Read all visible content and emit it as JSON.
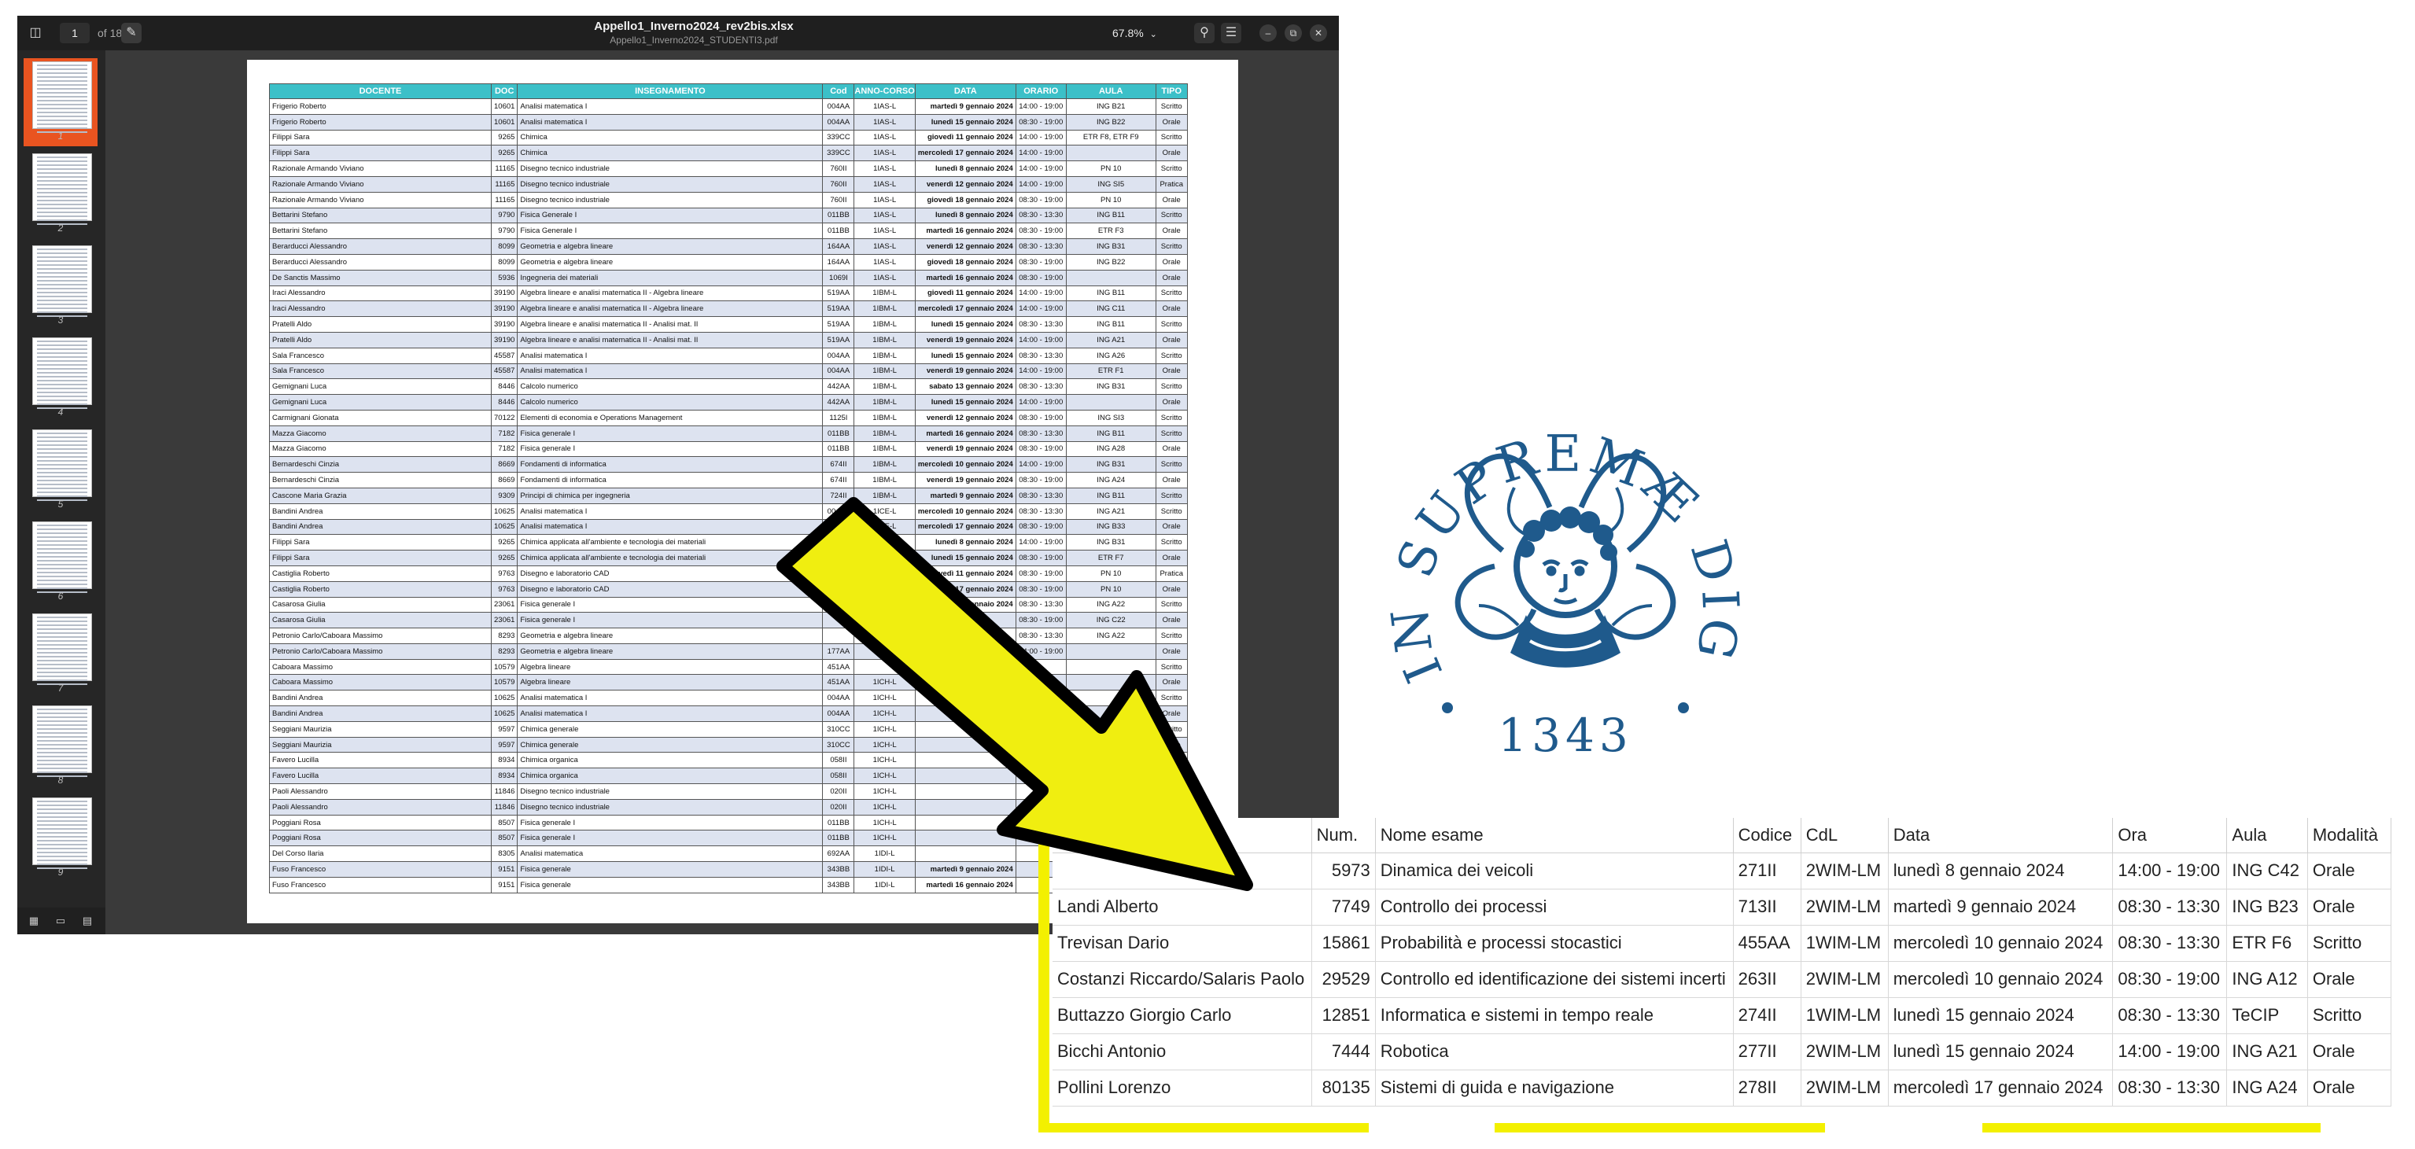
{
  "viewer": {
    "title": "Appello1_Inverno2024_rev2bis.xlsx",
    "subtitle": "Appello1_Inverno2024_STUDENTI3.pdf",
    "current_page": "1",
    "page_count_label": "of 18",
    "zoom_level": "67.8%",
    "accent_color": "#e95420",
    "thumbnail_labels": [
      "1",
      "2",
      "3",
      "4",
      "5",
      "6",
      "7",
      "8",
      "9"
    ]
  },
  "pdf_table": {
    "header_color": "#3cc0c8",
    "columns": [
      "DOCENTE",
      "DOC",
      "INSEGNAMENTO",
      "Cod",
      "ANNO-CORSO",
      "DATA",
      "ORARIO",
      "AULA",
      "TIPO"
    ],
    "rows": [
      [
        "Frigerio Roberto",
        "10601",
        "Analisi matematica I",
        "004AA",
        "1IAS-L",
        "martedì 9 gennaio 2024",
        "14:00 - 19:00",
        "ING B21",
        "Scritto"
      ],
      [
        "Frigerio Roberto",
        "10601",
        "Analisi matematica I",
        "004AA",
        "1IAS-L",
        "lunedì 15 gennaio 2024",
        "08:30 - 19:00",
        "ING B22",
        "Orale"
      ],
      [
        "Filippi Sara",
        "9265",
        "Chimica",
        "339CC",
        "1IAS-L",
        "giovedì 11 gennaio 2024",
        "14:00 - 19:00",
        "ETR F8, ETR F9",
        "Scritto"
      ],
      [
        "Filippi Sara",
        "9265",
        "Chimica",
        "339CC",
        "1IAS-L",
        "mercoledì 17 gennaio 2024",
        "14:00 - 19:00",
        "",
        "Orale"
      ],
      [
        "Razionale Armando Viviano",
        "11165",
        "Disegno tecnico industriale",
        "760II",
        "1IAS-L",
        "lunedì 8 gennaio 2024",
        "14:00 - 19:00",
        "PN 10",
        "Scritto"
      ],
      [
        "Razionale Armando Viviano",
        "11165",
        "Disegno tecnico industriale",
        "760II",
        "1IAS-L",
        "venerdì 12 gennaio 2024",
        "14:00 - 19:00",
        "ING SI5",
        "Pratica"
      ],
      [
        "Razionale Armando Viviano",
        "11165",
        "Disegno tecnico industriale",
        "760II",
        "1IAS-L",
        "giovedì 18 gennaio 2024",
        "08:30 - 19:00",
        "PN 10",
        "Orale"
      ],
      [
        "Bettarini Stefano",
        "9790",
        "Fisica Generale I",
        "011BB",
        "1IAS-L",
        "lunedì 8 gennaio 2024",
        "08:30 - 13:30",
        "ING B11",
        "Scritto"
      ],
      [
        "Bettarini Stefano",
        "9790",
        "Fisica Generale I",
        "011BB",
        "1IAS-L",
        "martedì 16 gennaio 2024",
        "08:30 - 19:00",
        "ETR F3",
        "Orale"
      ],
      [
        "Berarducci Alessandro",
        "8099",
        "Geometria e algebra lineare",
        "164AA",
        "1IAS-L",
        "venerdì 12 gennaio 2024",
        "08:30 - 13:30",
        "ING B31",
        "Scritto"
      ],
      [
        "Berarducci Alessandro",
        "8099",
        "Geometria e algebra lineare",
        "164AA",
        "1IAS-L",
        "giovedì 18 gennaio 2024",
        "08:30 - 19:00",
        "ING B22",
        "Orale"
      ],
      [
        "De Sanctis Massimo",
        "5936",
        "Ingegneria dei materiali",
        "1069I",
        "1IAS-L",
        "martedì 16 gennaio 2024",
        "08:30 - 19:00",
        "",
        "Orale"
      ],
      [
        "Iraci Alessandro",
        "39190",
        "Algebra lineare e analisi matematica II - Algebra lineare",
        "519AA",
        "1IBM-L",
        "giovedì 11 gennaio 2024",
        "14:00 - 19:00",
        "ING B11",
        "Scritto"
      ],
      [
        "Iraci Alessandro",
        "39190",
        "Algebra lineare e analisi matematica II - Algebra lineare",
        "519AA",
        "1IBM-L",
        "mercoledì 17 gennaio 2024",
        "14:00 - 19:00",
        "ING C11",
        "Orale"
      ],
      [
        "Pratelli Aldo",
        "39190",
        "Algebra lineare e analisi matematica II - Analisi mat. II",
        "519AA",
        "1IBM-L",
        "lunedì 15 gennaio 2024",
        "08:30 - 13:30",
        "ING B11",
        "Scritto"
      ],
      [
        "Pratelli Aldo",
        "39190",
        "Algebra lineare e analisi matematica II - Analisi mat. II",
        "519AA",
        "1IBM-L",
        "venerdì 19 gennaio 2024",
        "14:00 - 19:00",
        "ING A21",
        "Orale"
      ],
      [
        "Sala Francesco",
        "45587",
        "Analisi matematica I",
        "004AA",
        "1IBM-L",
        "lunedì 15 gennaio 2024",
        "08:30 - 13:30",
        "ING A26",
        "Scritto"
      ],
      [
        "Sala Francesco",
        "45587",
        "Analisi matematica I",
        "004AA",
        "1IBM-L",
        "venerdì 19 gennaio 2024",
        "14:00 - 19:00",
        "ETR F1",
        "Orale"
      ],
      [
        "Gemignani Luca",
        "8446",
        "Calcolo numerico",
        "442AA",
        "1IBM-L",
        "sabato 13 gennaio 2024",
        "08:30 - 13:30",
        "ING B31",
        "Scritto"
      ],
      [
        "Gemignani Luca",
        "8446",
        "Calcolo numerico",
        "442AA",
        "1IBM-L",
        "lunedì 15 gennaio 2024",
        "14:00 - 19:00",
        "",
        "Orale"
      ],
      [
        "Carmignani Gionata",
        "70122",
        "Elementi di economia e Operations Management",
        "1125I",
        "1IBM-L",
        "venerdì 12 gennaio 2024",
        "08:30 - 19:00",
        "ING SI3",
        "Scritto"
      ],
      [
        "Mazza Giacomo",
        "7182",
        "Fisica generale I",
        "011BB",
        "1IBM-L",
        "martedì 16 gennaio 2024",
        "08:30 - 13:30",
        "ING B11",
        "Scritto"
      ],
      [
        "Mazza Giacomo",
        "7182",
        "Fisica generale I",
        "011BB",
        "1IBM-L",
        "venerdì 19 gennaio 2024",
        "08:30 - 19:00",
        "ING A28",
        "Orale"
      ],
      [
        "Bernardeschi Cinzia",
        "8669",
        "Fondamenti di informatica",
        "674II",
        "1IBM-L",
        "mercoledì 10 gennaio 2024",
        "14:00 - 19:00",
        "ING B31",
        "Scritto"
      ],
      [
        "Bernardeschi Cinzia",
        "8669",
        "Fondamenti di informatica",
        "674II",
        "1IBM-L",
        "venerdì 19 gennaio 2024",
        "08:30 - 19:00",
        "ING A24",
        "Orale"
      ],
      [
        "Cascone Maria Grazia",
        "9309",
        "Principi di chimica per ingegneria",
        "724II",
        "1IBM-L",
        "martedì 9 gennaio 2024",
        "08:30 - 13:30",
        "ING B11",
        "Scritto"
      ],
      [
        "Bandini Andrea",
        "10625",
        "Analisi matematica I",
        "004AA",
        "1ICE-L",
        "mercoledì 10 gennaio 2024",
        "08:30 - 13:30",
        "ING A21",
        "Scritto"
      ],
      [
        "Bandini Andrea",
        "10625",
        "Analisi matematica I",
        "004AA",
        "1ICE-L",
        "mercoledì 17 gennaio 2024",
        "08:30 - 19:00",
        "ING B33",
        "Orale"
      ],
      [
        "Filippi Sara",
        "9265",
        "Chimica applicata all'ambiente e tecnologia dei materiali",
        "",
        "1ICE-L",
        "lunedì 8 gennaio 2024",
        "14:00 - 19:00",
        "ING B31",
        "Scritto"
      ],
      [
        "Filippi Sara",
        "9265",
        "Chimica applicata all'ambiente e tecnologia dei materiali",
        "",
        "1ICE-L",
        "lunedì 15 gennaio 2024",
        "08:30 - 19:00",
        "ETR F7",
        "Orale"
      ],
      [
        "Castiglia Roberto",
        "9763",
        "Disegno e laboratorio CAD",
        "",
        "",
        "giovedì 11 gennaio 2024",
        "08:30 - 19:00",
        "PN 10",
        "Pratica"
      ],
      [
        "Castiglia Roberto",
        "9763",
        "Disegno e laboratorio CAD",
        "",
        "",
        "mercoledì 17 gennaio 2024",
        "08:30 - 19:00",
        "PN 10",
        "Orale"
      ],
      [
        "Casarosa Giulia",
        "23061",
        "Fisica generale I",
        "",
        "",
        "venerdì 12 gennaio 2024",
        "08:30 - 13:30",
        "ING A22",
        "Scritto"
      ],
      [
        "Casarosa Giulia",
        "23061",
        "Fisica generale I",
        "",
        "",
        "",
        "08:30 - 19:00",
        "ING C22",
        "Orale"
      ],
      [
        "Petronio Carlo/Caboara Massimo",
        "8293",
        "Geometria e algebra lineare",
        "",
        "",
        "",
        "08:30 - 13:30",
        "ING A22",
        "Scritto"
      ],
      [
        "Petronio Carlo/Caboara Massimo",
        "8293",
        "Geometria e algebra lineare",
        "177AA",
        "",
        "",
        "14:00 - 19:00",
        "",
        "Orale"
      ],
      [
        "Caboara Massimo",
        "10579",
        "Algebra lineare",
        "451AA",
        "",
        "",
        "",
        "",
        "Scritto"
      ],
      [
        "Caboara Massimo",
        "10579",
        "Algebra lineare",
        "451AA",
        "1ICH-L",
        "",
        "",
        "",
        "Orale"
      ],
      [
        "Bandini Andrea",
        "10625",
        "Analisi matematica I",
        "004AA",
        "1ICH-L",
        "",
        "",
        "",
        "Scritto"
      ],
      [
        "Bandini Andrea",
        "10625",
        "Analisi matematica I",
        "004AA",
        "1ICH-L",
        "",
        "",
        "",
        "Orale"
      ],
      [
        "Seggiani Maurizia",
        "9597",
        "Chimica generale",
        "310CC",
        "1ICH-L",
        "",
        "",
        "",
        "Scritto"
      ],
      [
        "Seggiani Maurizia",
        "9597",
        "Chimica generale",
        "310CC",
        "1ICH-L",
        "",
        "",
        "",
        "Orale"
      ],
      [
        "Favero Lucilla",
        "8934",
        "Chimica organica",
        "058II",
        "1ICH-L",
        "",
        "",
        "",
        ""
      ],
      [
        "Favero Lucilla",
        "8934",
        "Chimica organica",
        "058II",
        "1ICH-L",
        "",
        "",
        "",
        ""
      ],
      [
        "Paoli Alessandro",
        "11846",
        "Disegno tecnico industriale",
        "020II",
        "1ICH-L",
        "",
        "",
        "",
        ""
      ],
      [
        "Paoli Alessandro",
        "11846",
        "Disegno tecnico industriale",
        "020II",
        "1ICH-L",
        "",
        "",
        "",
        ""
      ],
      [
        "Poggiani Rosa",
        "8507",
        "Fisica generale I",
        "011BB",
        "1ICH-L",
        "",
        "",
        "",
        ""
      ],
      [
        "Poggiani Rosa",
        "8507",
        "Fisica generale I",
        "011BB",
        "1ICH-L",
        "",
        "",
        "",
        ""
      ],
      [
        "Del Corso Ilaria",
        "8305",
        "Analisi matematica",
        "692AA",
        "1IDI-L",
        "",
        "",
        "",
        ""
      ],
      [
        "Fuso Francesco",
        "9151",
        "Fisica generale",
        "343BB",
        "1IDI-L",
        "martedì 9 gennaio 2024",
        "",
        "",
        ""
      ],
      [
        "Fuso Francesco",
        "9151",
        "Fisica generale",
        "343BB",
        "1IDI-L",
        "martedì 16 gennaio 2024",
        "",
        "",
        ""
      ]
    ]
  },
  "seal": {
    "motto": "IN SUPREMÆ DIGNITATIS",
    "year": "1343",
    "color": "#1f5a8c"
  },
  "arrow": {
    "fill": "#f0ee10",
    "stroke": "#000000"
  },
  "zoom_table": {
    "highlight_color": "#f3f000",
    "columns": [
      "Num.",
      "Nome esame",
      "Codice",
      "CdL",
      "Data",
      "Ora",
      "Aula",
      "Modalità"
    ],
    "rows": [
      [
        "",
        "5973",
        "Dinamica dei veicoli",
        "271II",
        "2WIM-LM",
        "lunedì 8 gennaio 2024",
        "14:00 - 19:00",
        "ING C42",
        "Orale"
      ],
      [
        "Landi Alberto",
        "7749",
        "Controllo dei processi",
        "713II",
        "2WIM-LM",
        "martedì 9 gennaio 2024",
        "08:30 - 13:30",
        "ING B23",
        "Orale"
      ],
      [
        "Trevisan Dario",
        "15861",
        "Probabilità e processi stocastici",
        "455AA",
        "1WIM-LM",
        "mercoledì 10 gennaio 2024",
        "08:30 - 13:30",
        "ETR F6",
        "Scritto"
      ],
      [
        "Costanzi Riccardo/Salaris Paolo",
        "29529",
        "Controllo ed identificazione dei sistemi incerti",
        "263II",
        "2WIM-LM",
        "mercoledì 10 gennaio 2024",
        "08:30 - 19:00",
        "ING A12",
        "Orale"
      ],
      [
        "Buttazzo Giorgio Carlo",
        "12851",
        "Informatica e sistemi in tempo reale",
        "274II",
        "1WIM-LM",
        "lunedì 15 gennaio 2024",
        "08:30 - 13:30",
        "TeCIP",
        "Scritto"
      ],
      [
        "Bicchi Antonio",
        "7444",
        "Robotica",
        "277II",
        "2WIM-LM",
        "lunedì 15 gennaio 2024",
        "14:00 - 19:00",
        "ING A21",
        "Orale"
      ],
      [
        "Pollini Lorenzo",
        "80135",
        "Sistemi di guida e navigazione",
        "278II",
        "2WIM-LM",
        "mercoledì 17 gennaio 2024",
        "08:30 - 13:30",
        "ING A24",
        "Orale"
      ]
    ]
  }
}
